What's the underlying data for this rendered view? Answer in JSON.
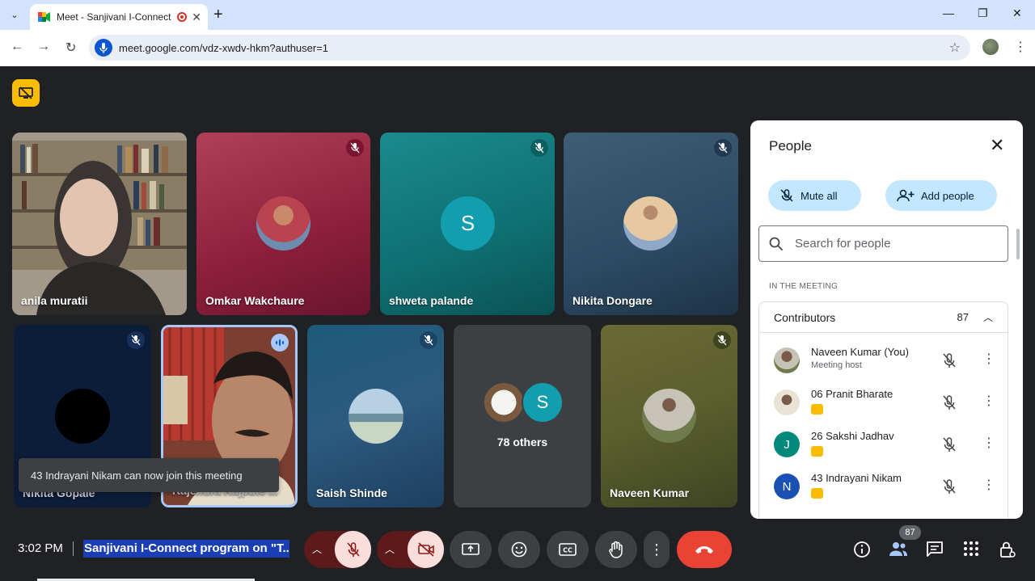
{
  "browser": {
    "tab_title": "Meet - Sanjivani I-Connect |",
    "url": "meet.google.com/vdz-xwdv-hkm?authuser=1"
  },
  "tiles": [
    {
      "name": "anila muratii"
    },
    {
      "name": "Omkar Wakchaure"
    },
    {
      "name": "shweta palande",
      "initial": "S"
    },
    {
      "name": "Nikita Dongare"
    },
    {
      "name": "Nikita Gopale"
    },
    {
      "name": "Rajendra Rajpute ..."
    },
    {
      "name": "Saish Shinde"
    },
    {
      "name": "78 others",
      "initial": "S"
    },
    {
      "name": "Naveen Kumar"
    }
  ],
  "toast": "43 Indrayani Nikam can now join this meeting",
  "people": {
    "title": "People",
    "mute_all": "Mute all",
    "add_people": "Add people",
    "search_placeholder": "Search for people",
    "section": "IN THE MEETING",
    "contributors_label": "Contributors",
    "contributors_count": "87",
    "rows": [
      {
        "name": "Naveen Kumar (You)",
        "sub": "Meeting host"
      },
      {
        "name": "06 Pranit Bharate"
      },
      {
        "name": "26 Sakshi Jadhav",
        "initial": "J",
        "color": "#00897b"
      },
      {
        "name": "43 Indrayani Nikam",
        "initial": "N",
        "color": "#1a4fb4"
      }
    ]
  },
  "bottom": {
    "time": "3:02 PM",
    "meeting_title": "Sanjivani I-Connect program on \"T...",
    "people_count": "87"
  },
  "colors": {
    "accent_blue": "#a8c7fa",
    "end_call": "#ea4335",
    "pill": "#c2e7ff"
  }
}
